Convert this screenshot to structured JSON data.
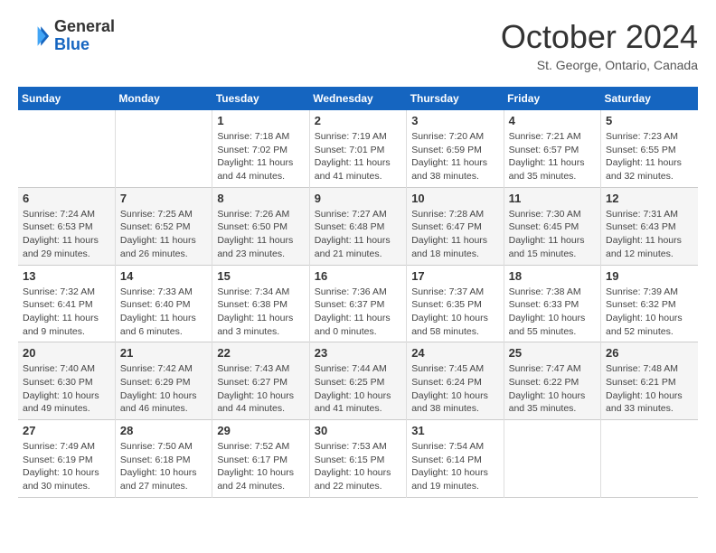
{
  "logo": {
    "line1": "General",
    "line2": "Blue"
  },
  "title": "October 2024",
  "location": "St. George, Ontario, Canada",
  "headers": [
    "Sunday",
    "Monday",
    "Tuesday",
    "Wednesday",
    "Thursday",
    "Friday",
    "Saturday"
  ],
  "rows": [
    [
      {
        "day": "",
        "info": ""
      },
      {
        "day": "",
        "info": ""
      },
      {
        "day": "1",
        "info": "Sunrise: 7:18 AM\nSunset: 7:02 PM\nDaylight: 11 hours and 44 minutes."
      },
      {
        "day": "2",
        "info": "Sunrise: 7:19 AM\nSunset: 7:01 PM\nDaylight: 11 hours and 41 minutes."
      },
      {
        "day": "3",
        "info": "Sunrise: 7:20 AM\nSunset: 6:59 PM\nDaylight: 11 hours and 38 minutes."
      },
      {
        "day": "4",
        "info": "Sunrise: 7:21 AM\nSunset: 6:57 PM\nDaylight: 11 hours and 35 minutes."
      },
      {
        "day": "5",
        "info": "Sunrise: 7:23 AM\nSunset: 6:55 PM\nDaylight: 11 hours and 32 minutes."
      }
    ],
    [
      {
        "day": "6",
        "info": "Sunrise: 7:24 AM\nSunset: 6:53 PM\nDaylight: 11 hours and 29 minutes."
      },
      {
        "day": "7",
        "info": "Sunrise: 7:25 AM\nSunset: 6:52 PM\nDaylight: 11 hours and 26 minutes."
      },
      {
        "day": "8",
        "info": "Sunrise: 7:26 AM\nSunset: 6:50 PM\nDaylight: 11 hours and 23 minutes."
      },
      {
        "day": "9",
        "info": "Sunrise: 7:27 AM\nSunset: 6:48 PM\nDaylight: 11 hours and 21 minutes."
      },
      {
        "day": "10",
        "info": "Sunrise: 7:28 AM\nSunset: 6:47 PM\nDaylight: 11 hours and 18 minutes."
      },
      {
        "day": "11",
        "info": "Sunrise: 7:30 AM\nSunset: 6:45 PM\nDaylight: 11 hours and 15 minutes."
      },
      {
        "day": "12",
        "info": "Sunrise: 7:31 AM\nSunset: 6:43 PM\nDaylight: 11 hours and 12 minutes."
      }
    ],
    [
      {
        "day": "13",
        "info": "Sunrise: 7:32 AM\nSunset: 6:41 PM\nDaylight: 11 hours and 9 minutes."
      },
      {
        "day": "14",
        "info": "Sunrise: 7:33 AM\nSunset: 6:40 PM\nDaylight: 11 hours and 6 minutes."
      },
      {
        "day": "15",
        "info": "Sunrise: 7:34 AM\nSunset: 6:38 PM\nDaylight: 11 hours and 3 minutes."
      },
      {
        "day": "16",
        "info": "Sunrise: 7:36 AM\nSunset: 6:37 PM\nDaylight: 11 hours and 0 minutes."
      },
      {
        "day": "17",
        "info": "Sunrise: 7:37 AM\nSunset: 6:35 PM\nDaylight: 10 hours and 58 minutes."
      },
      {
        "day": "18",
        "info": "Sunrise: 7:38 AM\nSunset: 6:33 PM\nDaylight: 10 hours and 55 minutes."
      },
      {
        "day": "19",
        "info": "Sunrise: 7:39 AM\nSunset: 6:32 PM\nDaylight: 10 hours and 52 minutes."
      }
    ],
    [
      {
        "day": "20",
        "info": "Sunrise: 7:40 AM\nSunset: 6:30 PM\nDaylight: 10 hours and 49 minutes."
      },
      {
        "day": "21",
        "info": "Sunrise: 7:42 AM\nSunset: 6:29 PM\nDaylight: 10 hours and 46 minutes."
      },
      {
        "day": "22",
        "info": "Sunrise: 7:43 AM\nSunset: 6:27 PM\nDaylight: 10 hours and 44 minutes."
      },
      {
        "day": "23",
        "info": "Sunrise: 7:44 AM\nSunset: 6:25 PM\nDaylight: 10 hours and 41 minutes."
      },
      {
        "day": "24",
        "info": "Sunrise: 7:45 AM\nSunset: 6:24 PM\nDaylight: 10 hours and 38 minutes."
      },
      {
        "day": "25",
        "info": "Sunrise: 7:47 AM\nSunset: 6:22 PM\nDaylight: 10 hours and 35 minutes."
      },
      {
        "day": "26",
        "info": "Sunrise: 7:48 AM\nSunset: 6:21 PM\nDaylight: 10 hours and 33 minutes."
      }
    ],
    [
      {
        "day": "27",
        "info": "Sunrise: 7:49 AM\nSunset: 6:19 PM\nDaylight: 10 hours and 30 minutes."
      },
      {
        "day": "28",
        "info": "Sunrise: 7:50 AM\nSunset: 6:18 PM\nDaylight: 10 hours and 27 minutes."
      },
      {
        "day": "29",
        "info": "Sunrise: 7:52 AM\nSunset: 6:17 PM\nDaylight: 10 hours and 24 minutes."
      },
      {
        "day": "30",
        "info": "Sunrise: 7:53 AM\nSunset: 6:15 PM\nDaylight: 10 hours and 22 minutes."
      },
      {
        "day": "31",
        "info": "Sunrise: 7:54 AM\nSunset: 6:14 PM\nDaylight: 10 hours and 19 minutes."
      },
      {
        "day": "",
        "info": ""
      },
      {
        "day": "",
        "info": ""
      }
    ]
  ]
}
